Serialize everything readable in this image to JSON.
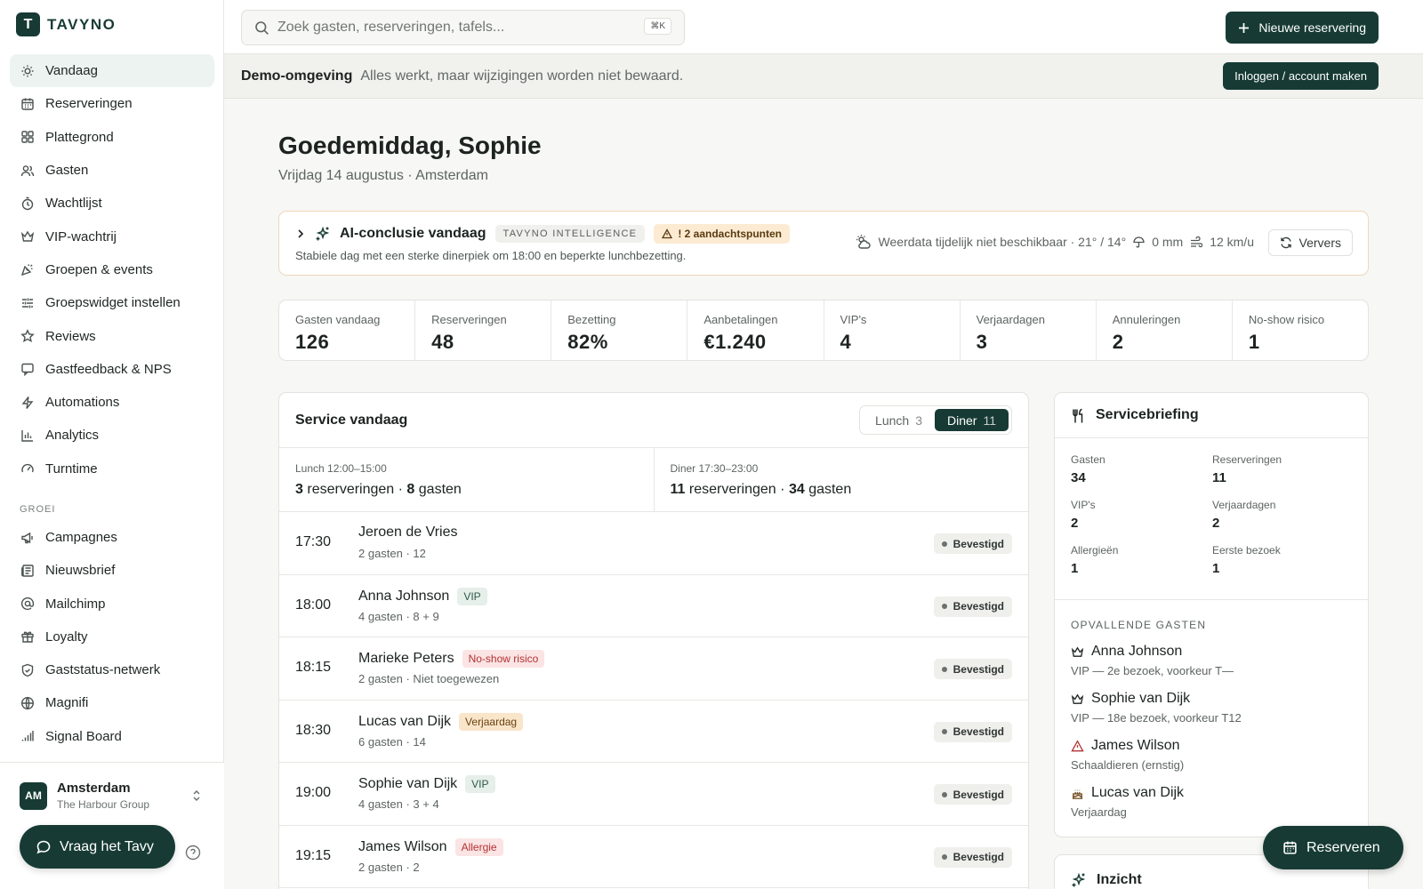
{
  "brand": {
    "name": "TAVYNO",
    "mark": "T"
  },
  "search": {
    "placeholder": "Zoek gasten, reserveringen, tafels...",
    "shortcut": "⌘K"
  },
  "topbar": {
    "new_reservation": "Nieuwe reservering"
  },
  "demo": {
    "title": "Demo-omgeving",
    "message": "Alles werkt, maar wijzigingen worden niet bewaard.",
    "login": "Inloggen / account maken"
  },
  "nav": {
    "items": [
      {
        "label": "Vandaag",
        "icon": "sun-icon",
        "active": true
      },
      {
        "label": "Reserveringen",
        "icon": "calendar-icon"
      },
      {
        "label": "Plattegrond",
        "icon": "grid-icon"
      },
      {
        "label": "Gasten",
        "icon": "users-icon"
      },
      {
        "label": "Wachtlijst",
        "icon": "timer-icon"
      },
      {
        "label": "VIP-wachtrij",
        "icon": "crown-icon"
      },
      {
        "label": "Groepen & events",
        "icon": "party-icon"
      },
      {
        "label": "Groepswidget instellen",
        "icon": "sliders-icon"
      },
      {
        "label": "Reviews",
        "icon": "star-icon"
      },
      {
        "label": "Gastfeedback & NPS",
        "icon": "message-icon"
      },
      {
        "label": "Automations",
        "icon": "bolt-icon"
      },
      {
        "label": "Analytics",
        "icon": "bar-chart-icon"
      },
      {
        "label": "Turntime",
        "icon": "gauge-icon"
      }
    ],
    "section": "GROEI",
    "growth": [
      {
        "label": "Campagnes",
        "icon": "megaphone-icon"
      },
      {
        "label": "Nieuwsbrief",
        "icon": "newspaper-icon"
      },
      {
        "label": "Mailchimp",
        "icon": "at-icon"
      },
      {
        "label": "Loyalty",
        "icon": "gift-icon"
      },
      {
        "label": "Gaststatus-netwerk",
        "icon": "shield-icon"
      },
      {
        "label": "Magnifi",
        "icon": "globe-icon"
      },
      {
        "label": "Signal Board",
        "icon": "signal-icon"
      }
    ]
  },
  "location": {
    "initials": "AM",
    "name": "Amsterdam",
    "group": "The Harbour Group"
  },
  "assistant": {
    "label": "Vraag het Tavy"
  },
  "greeting": {
    "title": "Goedemiddag, Sophie",
    "subtitle": "Vrijdag 14 augustus · Amsterdam"
  },
  "ai": {
    "title": "AI-conclusie vandaag",
    "tag": "TAVYNO INTELLIGENCE",
    "warning": "! 2 aandachtspunten",
    "description": "Stabiele dag met een sterke dinerpiek om 18:00 en beperkte lunchbezetting.",
    "weather": "Weerdata tijdelijk niet beschikbaar · 21° / 14°",
    "rain": "0 mm",
    "wind": "12 km/u",
    "refresh": "Ververs"
  },
  "stats": [
    {
      "label": "Gasten vandaag",
      "value": "126"
    },
    {
      "label": "Reserveringen",
      "value": "48"
    },
    {
      "label": "Bezetting",
      "value": "82%"
    },
    {
      "label": "Aanbetalingen",
      "value": "€1.240"
    },
    {
      "label": "VIP's",
      "value": "4"
    },
    {
      "label": "Verjaardagen",
      "value": "3"
    },
    {
      "label": "Annuleringen",
      "value": "2"
    },
    {
      "label": "No-show risico",
      "value": "1"
    }
  ],
  "service": {
    "title": "Service vandaag",
    "tabs": [
      {
        "label": "Lunch",
        "count": "3",
        "active": false
      },
      {
        "label": "Diner",
        "count": "11",
        "active": true
      }
    ],
    "lunch": {
      "label": "Lunch 12:00–15:00",
      "reservations": "3",
      "res_word": "reserveringen ·",
      "guests": "8",
      "guest_word": "gasten"
    },
    "dinner": {
      "label": "Diner 17:30–23:00",
      "reservations": "11",
      "res_word": "reserveringen ·",
      "guests": "34",
      "guest_word": "gasten"
    },
    "rows": [
      {
        "time": "17:30",
        "name": "Jeroen de Vries",
        "badge": "",
        "badge_type": "",
        "meta": "2 gasten · 12",
        "status": "Bevestigd"
      },
      {
        "time": "18:00",
        "name": "Anna Johnson",
        "badge": "VIP",
        "badge_type": "vip",
        "meta": "4 gasten · 8 + 9",
        "status": "Bevestigd"
      },
      {
        "time": "18:15",
        "name": "Marieke Peters",
        "badge": "No-show risico",
        "badge_type": "noshow",
        "meta": "2 gasten · Niet toegewezen",
        "status": "Bevestigd"
      },
      {
        "time": "18:30",
        "name": "Lucas van Dijk",
        "badge": "Verjaardag",
        "badge_type": "bday",
        "meta": "6 gasten · 14",
        "status": "Bevestigd"
      },
      {
        "time": "19:00",
        "name": "Sophie van Dijk",
        "badge": "VIP",
        "badge_type": "vip",
        "meta": "4 gasten · 3 + 4",
        "status": "Bevestigd"
      },
      {
        "time": "19:15",
        "name": "James Wilson",
        "badge": "Allergie",
        "badge_type": "allergy",
        "meta": "2 gasten · 2",
        "status": "Bevestigd"
      }
    ]
  },
  "briefing": {
    "title": "Servicebriefing",
    "stats": [
      {
        "label": "Gasten",
        "value": "34"
      },
      {
        "label": "Reserveringen",
        "value": "11"
      },
      {
        "label": "VIP's",
        "value": "2"
      },
      {
        "label": "Verjaardagen",
        "value": "2"
      },
      {
        "label": "Allergieën",
        "value": "1"
      },
      {
        "label": "Eerste bezoek",
        "value": "1"
      }
    ],
    "section": "OPVALLENDE GASTEN",
    "guests": [
      {
        "icon": "crown-icon",
        "name": "Anna Johnson",
        "detail": "VIP — 2e bezoek, voorkeur T—"
      },
      {
        "icon": "crown-icon",
        "name": "Sophie van Dijk",
        "detail": "VIP — 18e bezoek, voorkeur T12"
      },
      {
        "icon": "alert-triangle-icon",
        "name": "James Wilson",
        "detail": "Schaaldieren (ernstig)"
      },
      {
        "icon": "cake-icon",
        "name": "Lucas van Dijk",
        "detail": "Verjaardag"
      }
    ]
  },
  "insight": {
    "title": "Inzicht"
  },
  "reserve": {
    "label": "Reserveren"
  },
  "colors": {
    "brand": "#173b34",
    "warn_bg": "#fcebd2",
    "vip_bg": "#e6efe9",
    "danger": "#b33232"
  }
}
